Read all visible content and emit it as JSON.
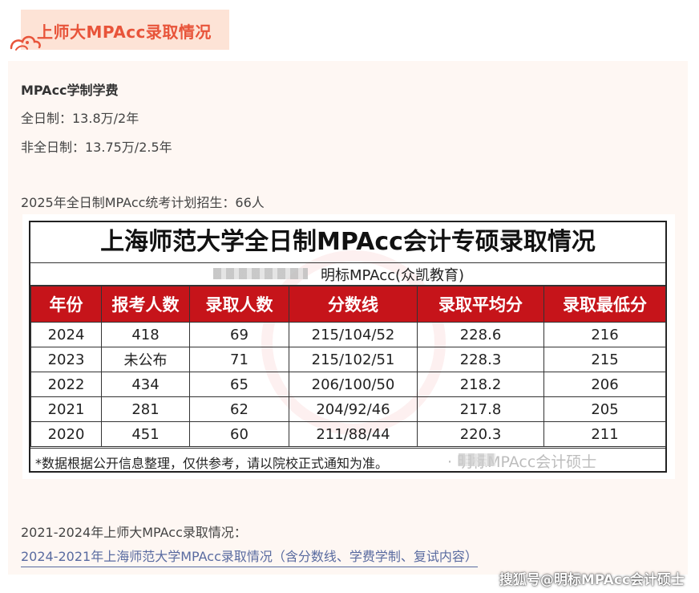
{
  "section_tag": {
    "title": "上师大MPAcc录取情况"
  },
  "intro": {
    "heading": "MPAcc学制学费",
    "full_time": "全日制：13.8万/2年",
    "part_time": "非全日制：13.75万/2.5年",
    "plan": "2025年全日制MPAcc统考计划招生：66人"
  },
  "table": {
    "title": "上海师范大学全日制MPAcc会计专硕录取情况",
    "subtitle": "明标MPAcc(众凯教育)",
    "headers": [
      "年份",
      "报考人数",
      "录取人数",
      "分数线",
      "录取平均分",
      "录取最低分"
    ],
    "rows": [
      [
        "2024",
        "418",
        "69",
        "215/104/52",
        "228.6",
        "216"
      ],
      [
        "2023",
        "未公布",
        "71",
        "215/102/51",
        "228.3",
        "215"
      ],
      [
        "2022",
        "434",
        "65",
        "206/100/50",
        "218.2",
        "206"
      ],
      [
        "2021",
        "281",
        "62",
        "204/92/46",
        "217.8",
        "205"
      ],
      [
        "2020",
        "451",
        "60",
        "211/88/44",
        "220.3",
        "211"
      ]
    ],
    "footnote": "*数据根据公开信息整理，仅供参考，请以院校正式通知为准。",
    "watermark": "· 明标MPAcc会计硕士",
    "header_color": "#c6141a"
  },
  "bottom": {
    "label": "2021-2024年上师大MPAcc录取情况：",
    "link": "2024-2021年上海师范大学MPAcc录取情况（含分数线、学费学制、复试内容）"
  },
  "source_watermark": "搜狐号@明标MPAcc会计硕士"
}
